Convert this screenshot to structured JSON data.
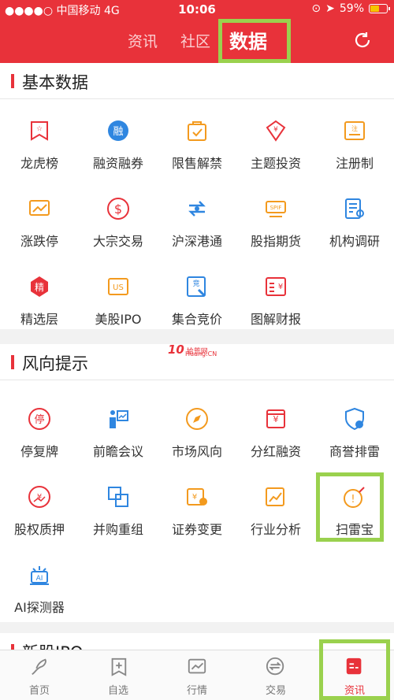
{
  "status_bar": {
    "carrier": "中国移动",
    "network": "4G",
    "time": "10:06",
    "battery": "59%",
    "battery_level": 0.59
  },
  "top_nav": {
    "tabs": [
      "资讯",
      "社区",
      "数据"
    ],
    "active": "数据"
  },
  "sections": [
    {
      "title": "基本数据",
      "items": [
        {
          "label": "龙虎榜",
          "icon": "dragon-tiger-list-icon"
        },
        {
          "label": "融资融券",
          "icon": "margin-trading-icon"
        },
        {
          "label": "限售解禁",
          "icon": "lockup-expiry-icon"
        },
        {
          "label": "主题投资",
          "icon": "theme-investing-icon"
        },
        {
          "label": "注册制",
          "icon": "registration-system-icon"
        },
        {
          "label": "涨跌停",
          "icon": "limit-up-down-icon"
        },
        {
          "label": "大宗交易",
          "icon": "block-trade-icon"
        },
        {
          "label": "沪深港通",
          "icon": "stock-connect-icon"
        },
        {
          "label": "股指期货",
          "icon": "index-futures-icon"
        },
        {
          "label": "机构调研",
          "icon": "institutional-research-icon"
        },
        {
          "label": "精选层",
          "icon": "select-tier-icon"
        },
        {
          "label": "美股IPO",
          "icon": "us-ipo-icon"
        },
        {
          "label": "集合竞价",
          "icon": "call-auction-icon"
        },
        {
          "label": "图解财报",
          "icon": "financial-report-icon"
        }
      ]
    },
    {
      "title": "风向提示",
      "items": [
        {
          "label": "停复牌",
          "icon": "suspension-icon"
        },
        {
          "label": "前瞻会议",
          "icon": "forward-meeting-icon"
        },
        {
          "label": "市场风向",
          "icon": "market-compass-icon"
        },
        {
          "label": "分红融资",
          "icon": "dividend-financing-icon"
        },
        {
          "label": "商誉排雷",
          "icon": "goodwill-check-icon"
        },
        {
          "label": "股权质押",
          "icon": "equity-pledge-icon"
        },
        {
          "label": "并购重组",
          "icon": "merger-icon"
        },
        {
          "label": "证券变更",
          "icon": "security-change-icon"
        },
        {
          "label": "行业分析",
          "icon": "industry-analysis-icon"
        },
        {
          "label": "扫雷宝",
          "icon": "mine-sweeper-icon"
        },
        {
          "label": "AI探测器",
          "icon": "ai-detector-icon"
        }
      ]
    }
  ],
  "partial_section_title": "新股IPO",
  "watermark": {
    "logo": "10",
    "site": "拾荒网",
    "domain": "Huang.CN"
  },
  "tab_bar": [
    {
      "label": "首页",
      "icon": "home-icon"
    },
    {
      "label": "自选",
      "icon": "watchlist-icon"
    },
    {
      "label": "行情",
      "icon": "market-chart-icon"
    },
    {
      "label": "交易",
      "icon": "trade-icon"
    },
    {
      "label": "资讯",
      "icon": "news-icon"
    }
  ],
  "colors": {
    "brand_red": "#e8323a",
    "icon_orange": "#f39a1e",
    "icon_blue": "#2f86e0",
    "highlight_green": "#9ad14e"
  }
}
